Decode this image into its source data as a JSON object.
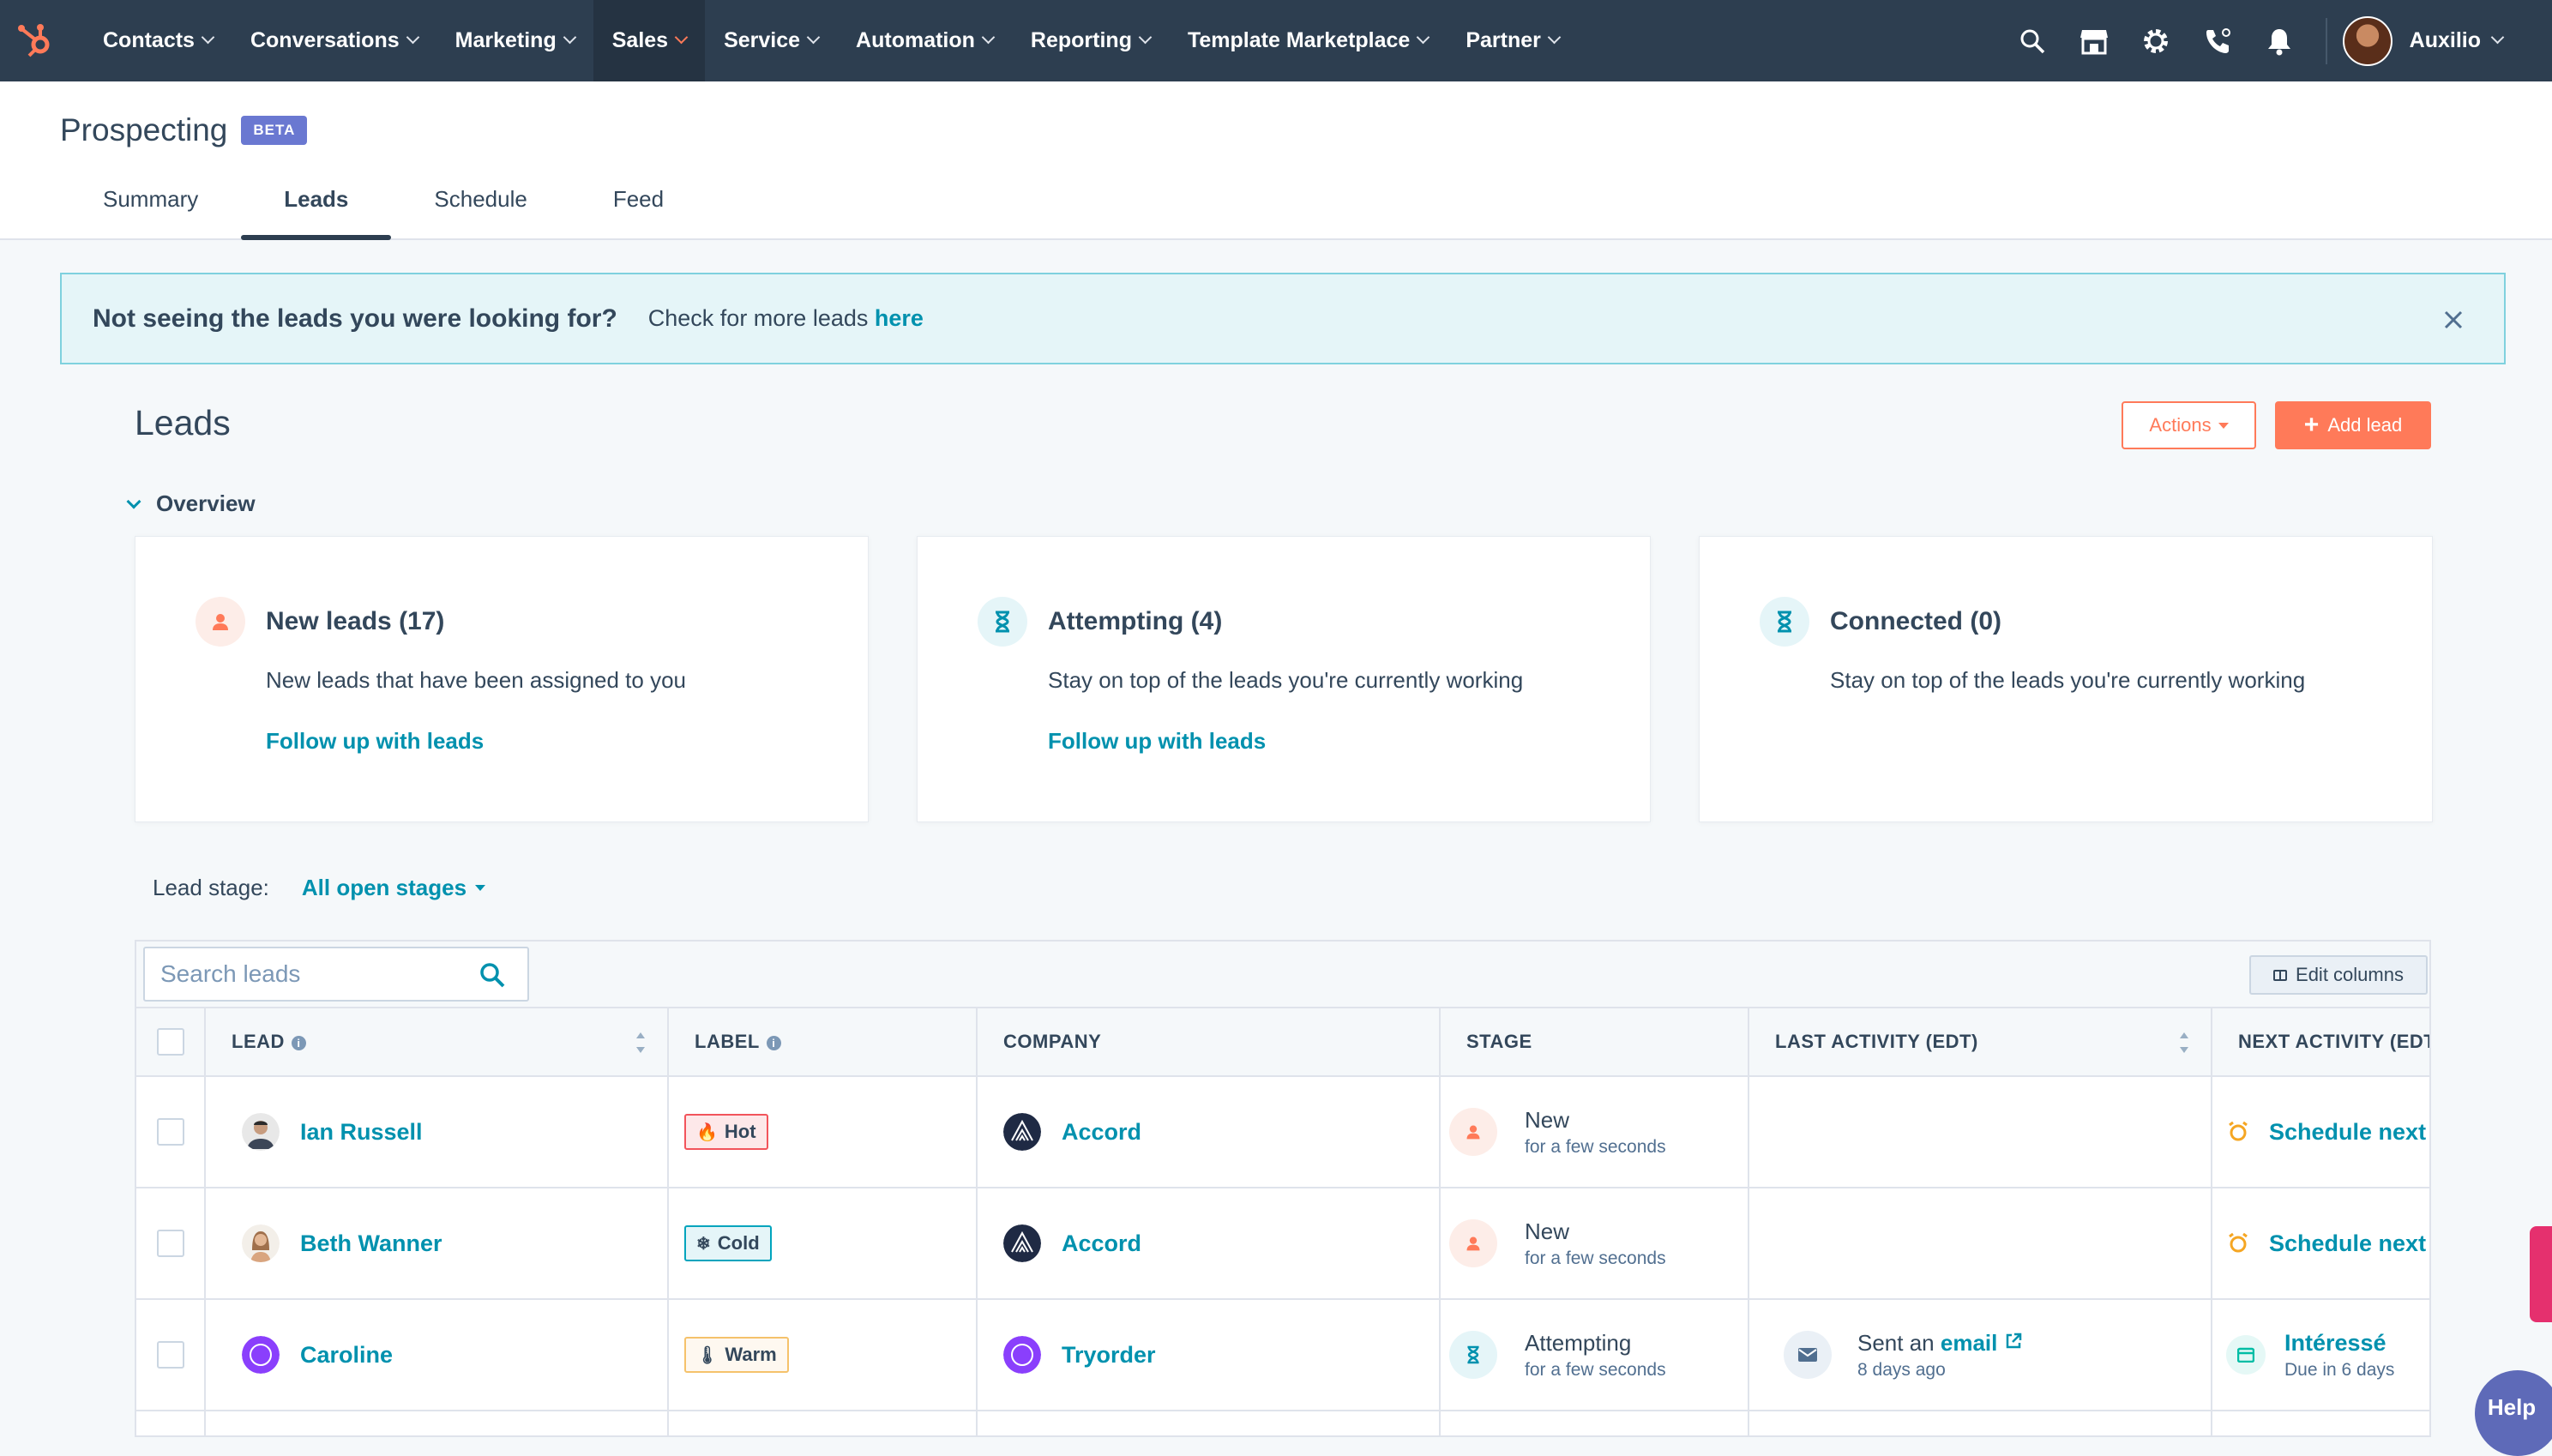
{
  "nav": {
    "items": [
      {
        "label": "Contacts"
      },
      {
        "label": "Conversations"
      },
      {
        "label": "Marketing"
      },
      {
        "label": "Sales"
      },
      {
        "label": "Service"
      },
      {
        "label": "Automation"
      },
      {
        "label": "Reporting"
      },
      {
        "label": "Template Marketplace"
      },
      {
        "label": "Partner"
      }
    ],
    "active": "Sales",
    "account_name": "Auxilio",
    "icons": [
      "search-icon",
      "marketplace-icon",
      "settings-icon",
      "calling-icon",
      "notifications-icon"
    ]
  },
  "page": {
    "title": "Prospecting",
    "badge": "BETA",
    "tabs": [
      {
        "label": "Summary"
      },
      {
        "label": "Leads"
      },
      {
        "label": "Schedule"
      },
      {
        "label": "Feed"
      }
    ],
    "active_tab": "Leads"
  },
  "banner": {
    "title": "Not seeing the leads you were looking for?",
    "text": "Check for more leads",
    "link": "here"
  },
  "leads": {
    "heading": "Leads",
    "actions_label": "Actions",
    "add_label": "Add lead",
    "overview_label": "Overview",
    "cards": [
      {
        "title": "New leads (17)",
        "desc": "New leads that have been assigned to you",
        "link": "Follow up with leads",
        "icon": "person-icon"
      },
      {
        "title": "Attempting (4)",
        "desc": "Stay on top of the leads you're currently working",
        "link": "Follow up with leads",
        "icon": "hourglass-icon"
      },
      {
        "title": "Connected (0)",
        "desc": "Stay on top of the leads you're currently working",
        "link": "",
        "icon": "hourglass-icon"
      }
    ],
    "stage_filter_label": "Lead stage:",
    "stage_filter_value": "All open stages"
  },
  "table": {
    "search_placeholder": "Search leads",
    "edit_columns_label": "Edit columns",
    "columns": [
      "LEAD",
      "LABEL",
      "COMPANY",
      "STAGE",
      "LAST ACTIVITY (EDT)",
      "NEXT ACTIVITY (EDT)"
    ],
    "rows": [
      {
        "lead": "Ian Russell",
        "label": "Hot",
        "label_icon": "fire-icon",
        "company": "Accord",
        "stage": "New",
        "stage_time": "for a few seconds",
        "last_activity_prefix": "",
        "last_activity_link": "",
        "last_activity_time": "",
        "next_activity": "Schedule next",
        "next_activity_sub": ""
      },
      {
        "lead": "Beth Wanner",
        "label": "Cold",
        "label_icon": "snow-icon",
        "company": "Accord",
        "stage": "New",
        "stage_time": "for a few seconds",
        "last_activity_prefix": "",
        "last_activity_link": "",
        "last_activity_time": "",
        "next_activity": "Schedule next",
        "next_activity_sub": ""
      },
      {
        "lead": "Caroline",
        "label": "Warm",
        "label_icon": "warm-icon",
        "company": "Tryorder",
        "stage": "Attempting",
        "stage_time": "for a few seconds",
        "last_activity_prefix": "Sent an",
        "last_activity_link": "email",
        "last_activity_time": "8 days ago",
        "next_activity": "Intéressé",
        "next_activity_sub": "Due in 6 days"
      }
    ]
  },
  "help_label": "Help",
  "colors": {
    "nav_bg": "#2d3e50",
    "accent": "#ff7a59",
    "link": "#0091ae",
    "beta": "#6a78d1",
    "banner_bg": "#e5f5f8"
  }
}
